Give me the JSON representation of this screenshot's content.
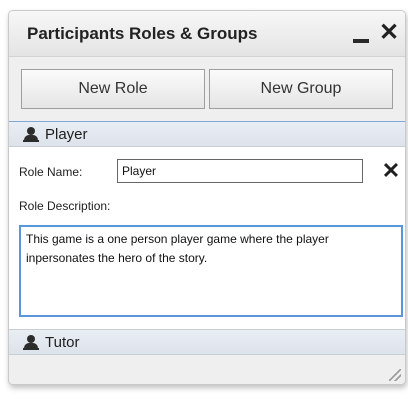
{
  "window": {
    "title": "Participants Roles & Groups",
    "minimize_icon": "minimize-icon",
    "close_icon": "close-icon"
  },
  "toolbar": {
    "new_role_label": "New Role",
    "new_group_label": "New Group"
  },
  "roles": [
    {
      "name": "Player",
      "icon": "person-icon",
      "expanded": true,
      "role_name_label": "Role Name:",
      "role_name_value": "Player",
      "role_description_label": "Role Description:",
      "role_description_value": "This game is a one person player game where the player inpersonates the hero of the story."
    },
    {
      "name": "Tutor",
      "icon": "person-icon",
      "expanded": false
    }
  ],
  "colors": {
    "focus_border": "#5b97d8",
    "panel_bg": "#efefef",
    "section_header_bg": "#e3e8ef"
  }
}
